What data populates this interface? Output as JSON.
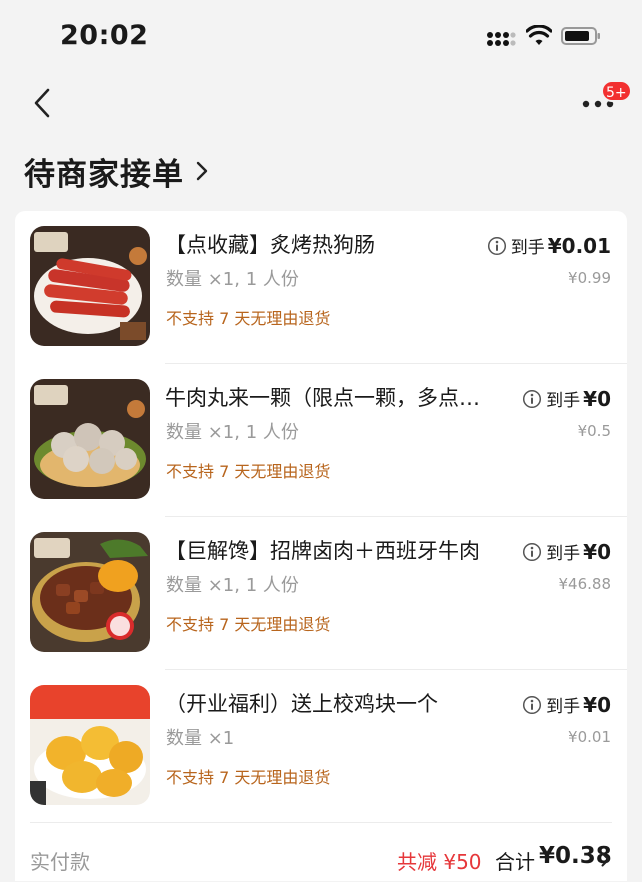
{
  "status_bar": {
    "time": "20:02"
  },
  "nav": {
    "notification_badge": "5+"
  },
  "header": {
    "title": "待商家接单"
  },
  "items": [
    {
      "name": "【点收藏】炙烤热狗肠",
      "quantity": "数量 ×1, 1 人份",
      "policy": "不支持 7 天无理由退货",
      "price_label": "到手",
      "price": "¥0.01",
      "original_price": "¥0.99",
      "image_icon": "hot-dog-sausage-image"
    },
    {
      "name": "牛肉丸来一颗（限点一颗，多点不送）",
      "quantity": "数量 ×1, 1 人份",
      "policy": "不支持 7 天无理由退货",
      "price_label": "到手",
      "price": "¥0",
      "original_price": "¥0.5",
      "image_icon": "beef-ball-image"
    },
    {
      "name": "【巨解馋】招牌卤肉＋西班牙牛肉",
      "quantity": "数量 ×1, 1 人份",
      "policy": "不支持 7 天无理由退货",
      "price_label": "到手",
      "price": "¥0",
      "original_price": "¥46.88",
      "image_icon": "braised-pork-image"
    },
    {
      "name": "（开业福利）送上校鸡块一个",
      "quantity": "数量 ×1",
      "policy": "不支持 7 天无理由退货",
      "price_label": "到手",
      "price": "¥0",
      "original_price": "¥0.01",
      "image_icon": "chicken-nugget-image"
    }
  ],
  "footer": {
    "paid_label": "实付款",
    "discount": "共减 ¥50",
    "total_label": "合计",
    "total": "¥0.38"
  },
  "colors": {
    "accent_red": "#e6373a",
    "policy_orange": "#b8651d",
    "badge_red": "#f23030"
  }
}
